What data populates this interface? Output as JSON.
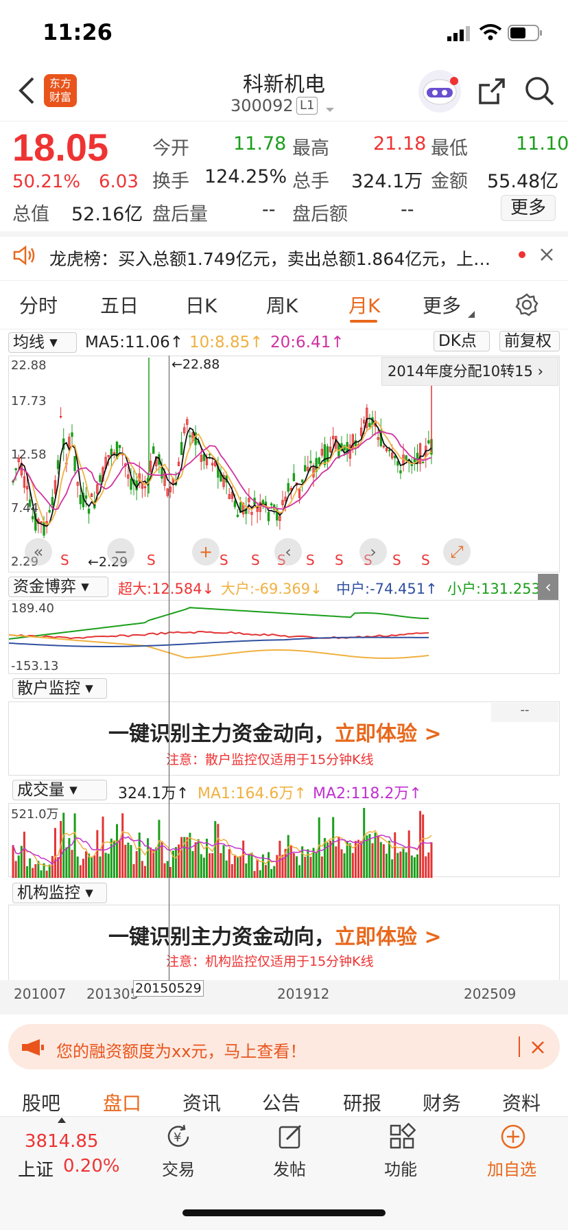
{
  "status": {
    "time": "11:26"
  },
  "header": {
    "title": "科新机电",
    "code": "300092",
    "badge": "L1",
    "logo_line1": "东方",
    "logo_line2": "财富"
  },
  "quote": {
    "price": "18.05",
    "change_pct": "50.21%",
    "change_amt": "6.03",
    "open_label": "今开",
    "open": "11.78",
    "high_label": "最高",
    "high": "21.18",
    "low_label": "最低",
    "low": "11.10",
    "turnover_label": "换手",
    "turnover": "124.25%",
    "volume_label": "总手",
    "volume": "324.1万",
    "amount_label": "金额",
    "amount": "55.48亿",
    "cap_label": "总值",
    "cap": "52.16亿",
    "ah_vol_label": "盘后量",
    "ah_vol": "--",
    "ah_amt_label": "盘后额",
    "ah_amt": "--",
    "more": "更多"
  },
  "notice": {
    "text": "龙虎榜：买入总额1.749亿元，卖出总额1.864亿元，上…"
  },
  "tabs": [
    "分时",
    "五日",
    "日K",
    "周K",
    "月K",
    "更多"
  ],
  "kline": {
    "indicator": "均线",
    "ma5": "MA5:11.06",
    "ma10": "10:8.85",
    "ma20": "20:6.41",
    "dk": "DK点",
    "fq": "前复权",
    "y_max": "22.88",
    "y2": "17.73",
    "y3": "12.58",
    "y4": "7.44",
    "y_min": "2.29",
    "peak_label": "22.88",
    "low_label": "2.29",
    "event": "2014年度分配10转15",
    "s_marks": [
      "S",
      "S",
      "S",
      "S",
      "S",
      "S",
      "S",
      "S",
      "S",
      "S",
      "S",
      "S"
    ]
  },
  "capital": {
    "indicator": "资金博弈",
    "super": "超大:12.584",
    "big": "大户:-69.369",
    "mid": "中户:-74.451",
    "small": "小户:131.253",
    "y_max": "189.40",
    "y_min": "-153.13"
  },
  "retail": {
    "indicator": "散户监控",
    "dash": "--",
    "title_a": "一键识别主力资金动向，",
    "title_b": "立即体验 >",
    "note": "注意：散户监控仅适用于15分钟K线"
  },
  "vol": {
    "indicator": "成交量",
    "total": "324.1万",
    "ma1": "MA1:164.6万",
    "ma2": "MA2:118.2万",
    "y_max": "521.0万"
  },
  "inst": {
    "indicator": "机构监控",
    "title_a": "一键识别主力资金动向，",
    "title_b": "立即体验 >",
    "note": "注意：机构监控仅适用于15分钟K线"
  },
  "dates": {
    "d1": "201007",
    "d2": "201305",
    "d3": "20150529",
    "d4": "201912",
    "d5": "202509"
  },
  "banner": {
    "text": "您的融资额度为xx元，马上查看！"
  },
  "subtabs": [
    "股吧",
    "盘口",
    "资讯",
    "公告",
    "研报",
    "财务",
    "资料"
  ],
  "bottom": {
    "index_value": "3814.85",
    "index_name": "上证",
    "index_pct": "0.20%",
    "trade": "交易",
    "post": "发帖",
    "func": "功能",
    "add": "加自选"
  },
  "colors": {
    "red": "#e33333",
    "green": "#1a9e1a",
    "orange": "#e8681c",
    "ma10": "#f0b040",
    "ma20": "#d030a0",
    "blue": "#3050a0"
  }
}
